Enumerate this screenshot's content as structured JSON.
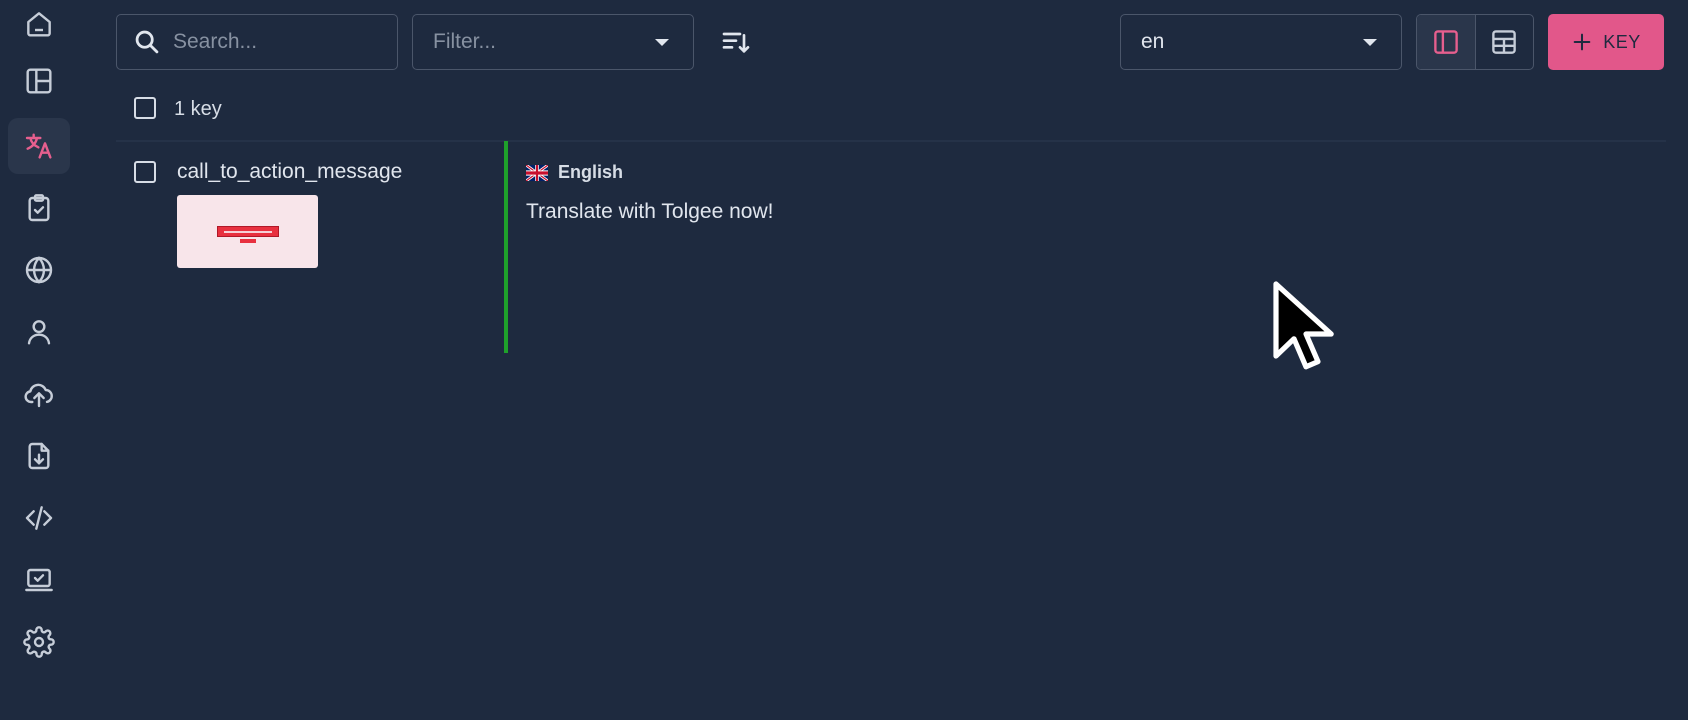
{
  "sidebar": {
    "items": [
      {
        "name": "home-icon"
      },
      {
        "name": "dashboard-icon"
      },
      {
        "name": "translations-icon",
        "active": true
      },
      {
        "name": "tasks-icon"
      },
      {
        "name": "languages-icon"
      },
      {
        "name": "members-icon"
      },
      {
        "name": "import-icon"
      },
      {
        "name": "export-icon"
      },
      {
        "name": "developer-icon"
      },
      {
        "name": "integrate-icon"
      },
      {
        "name": "settings-icon"
      }
    ]
  },
  "toolbar": {
    "search_placeholder": "Search...",
    "filter_placeholder": "Filter...",
    "language_value": "en",
    "add_key_label": "KEY",
    "accent_color": "#e2578a"
  },
  "list": {
    "count_label": "1 key",
    "rows": [
      {
        "key": "call_to_action_message",
        "language": "English",
        "translation": "Translate with Tolgee now!",
        "state_color": "#1fa12b"
      }
    ]
  }
}
